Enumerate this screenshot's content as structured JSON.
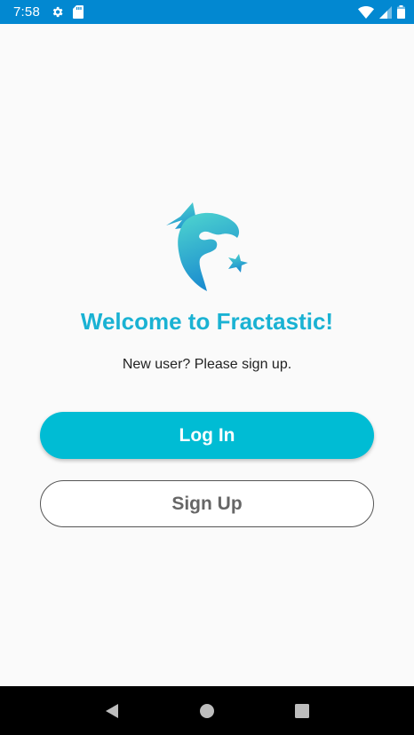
{
  "status_bar": {
    "time": "7:58",
    "background_color": "#0288d1",
    "icons_left": [
      "settings-icon",
      "sd-card-icon"
    ],
    "icons_right": [
      "wifi-icon",
      "signal-icon",
      "battery-icon"
    ]
  },
  "app": {
    "logo": "fractastic-logo",
    "title": "Welcome to Fractastic!",
    "subtitle": "New user? Please sign up.",
    "accent_color": "#00bcd4",
    "title_color": "#1ab2d3"
  },
  "buttons": {
    "login_label": "Log In",
    "signup_label": "Sign Up"
  },
  "nav_bar": {
    "icons": [
      "back-icon",
      "home-icon",
      "recents-icon"
    ]
  }
}
